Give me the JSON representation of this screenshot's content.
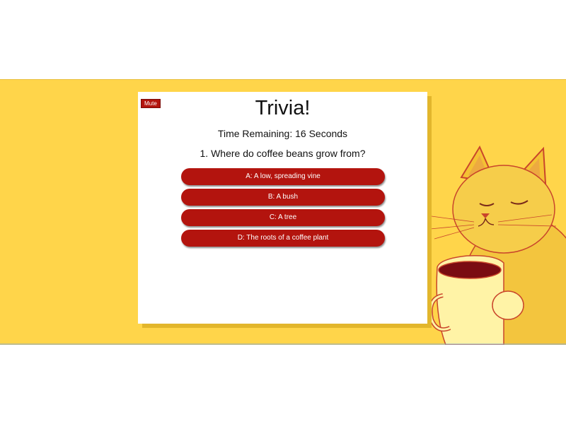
{
  "colors": {
    "background_band": "#ffd54a",
    "card": "#ffffff",
    "button": "#b3140e",
    "button_text": "#ffffff"
  },
  "mute_button": {
    "label": "Mute"
  },
  "quiz": {
    "title": "Trivia!",
    "timer_text": "Time Remaining: 16 Seconds",
    "question": "1. Where do coffee beans grow from?",
    "answers": [
      {
        "label": "A: A low, spreading vine"
      },
      {
        "label": "B: A bush"
      },
      {
        "label": "C: A tree"
      },
      {
        "label": "D: The roots of a coffee plant"
      }
    ]
  },
  "illustration": {
    "icon": "cat-with-coffee-mug-illustration"
  }
}
